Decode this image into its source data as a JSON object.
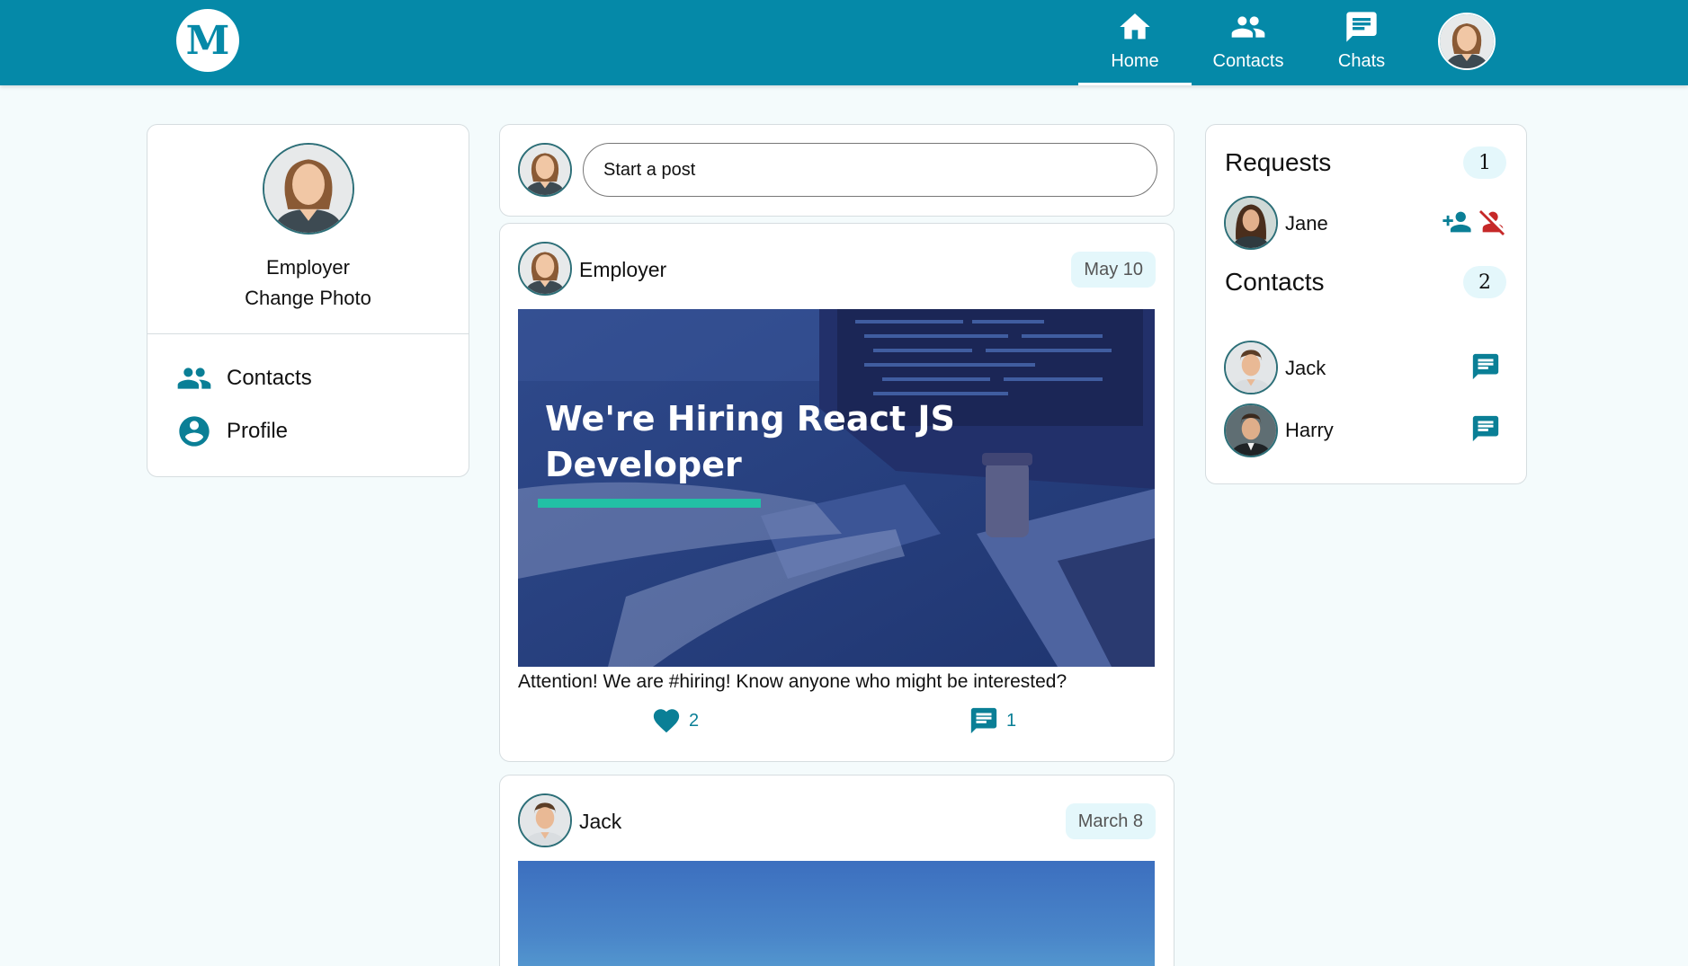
{
  "app": {
    "logo_letter": "M"
  },
  "nav": {
    "items": [
      {
        "label": "Home",
        "icon": "home-icon",
        "active": true
      },
      {
        "label": "Contacts",
        "icon": "contacts-icon",
        "active": false
      },
      {
        "label": "Chats",
        "icon": "chat-icon",
        "active": false
      }
    ]
  },
  "profile": {
    "name": "Employer",
    "change_photo": "Change Photo",
    "links": [
      {
        "label": "Contacts",
        "icon": "contacts-icon"
      },
      {
        "label": "Profile",
        "icon": "account-circle-icon"
      }
    ]
  },
  "composer": {
    "placeholder": "Start a post"
  },
  "posts": [
    {
      "author": "Employer",
      "date": "May 10",
      "image_headline_line1": "We're Hiring React JS",
      "image_headline_line2": "Developer",
      "text": "Attention! We are #hiring! Know anyone who might be interested?",
      "likes": "2",
      "comments": "1"
    },
    {
      "author": "Jack",
      "date": "March 8"
    }
  ],
  "requests": {
    "title": "Requests",
    "count": "1",
    "items": [
      {
        "name": "Jane"
      }
    ]
  },
  "contacts": {
    "title": "Contacts",
    "count": "2",
    "items": [
      {
        "name": "Jack"
      },
      {
        "name": "Harry"
      }
    ]
  },
  "colors": {
    "primary": "#0589a8",
    "accent_icon": "#0a7f96",
    "decline_red": "#c62828",
    "pill_bg": "#e4f7fb",
    "page_bg": "#f4fbfc"
  }
}
